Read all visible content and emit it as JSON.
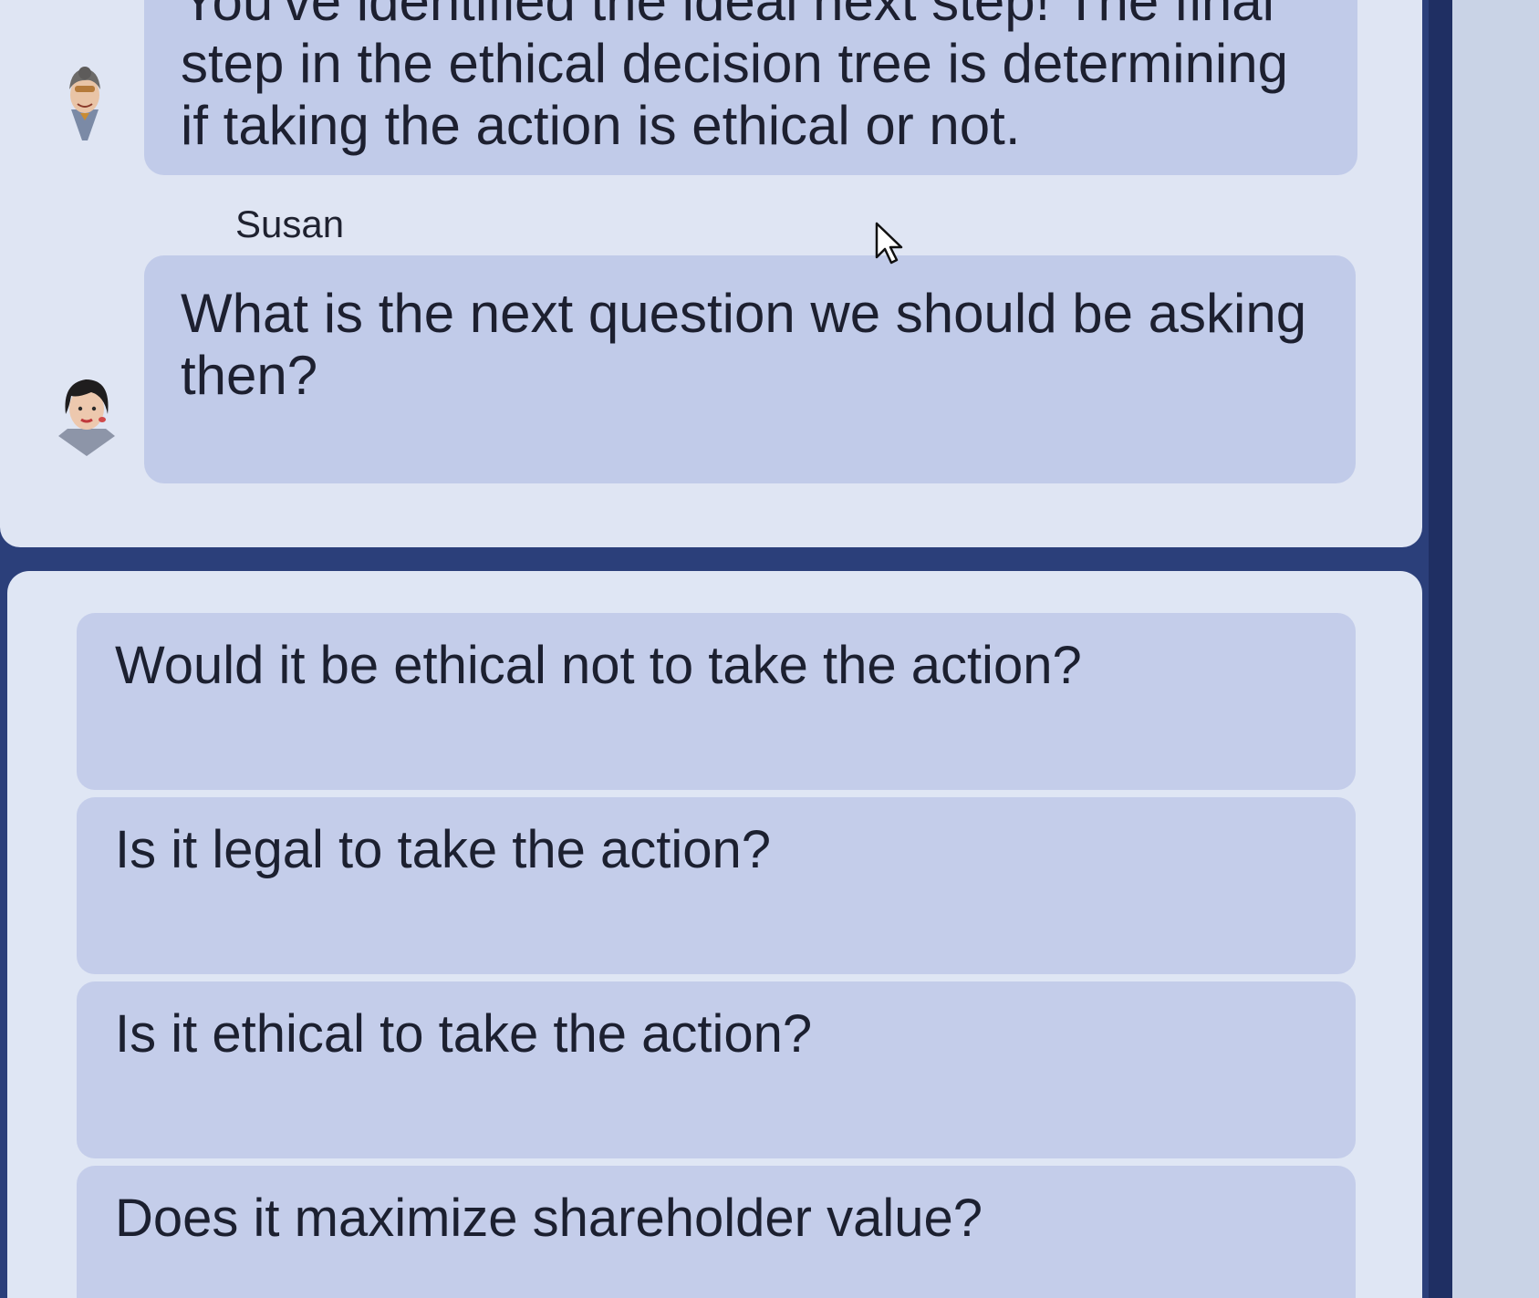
{
  "chat": {
    "messages": [
      {
        "speaker": "",
        "avatar": "guide-avatar-icon",
        "lines": [
          "You've identified the ideal next step! The final",
          "step in the ethical decision tree is determining",
          "if taking the action is ethical or not."
        ]
      },
      {
        "speaker": "Susan",
        "avatar": "susan-avatar-icon",
        "lines": [
          "What is the next question we should be asking",
          "then?"
        ]
      }
    ]
  },
  "answers": {
    "options": [
      "Would it be ethical not to take the action?",
      "Is it legal to take the action?",
      "Is it ethical to take the action?",
      "Does it maximize shareholder value?"
    ]
  },
  "colors": {
    "frame": "#2b3f7a",
    "panel": "#dfe5f3",
    "bubble": "#c1cbe9",
    "option": "#c4cdea"
  }
}
